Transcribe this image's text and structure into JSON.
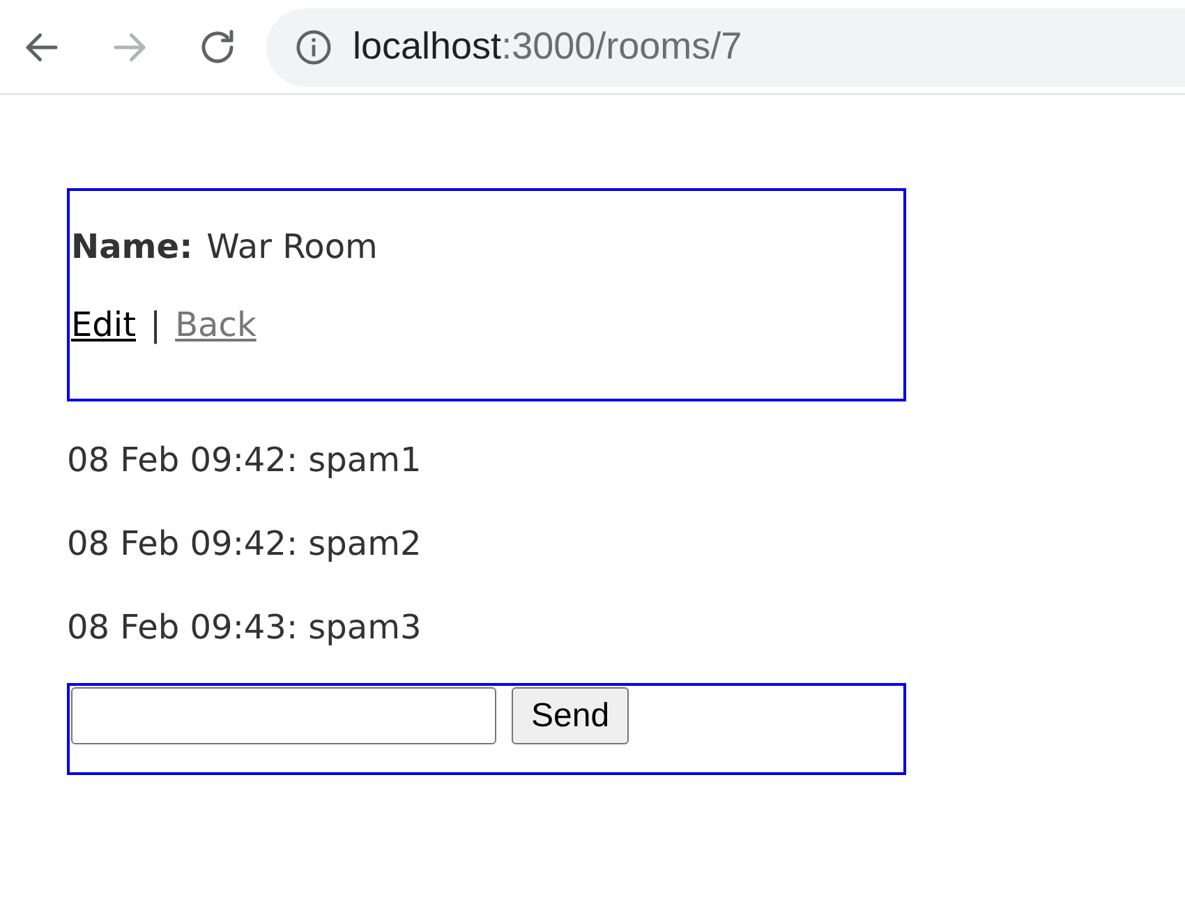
{
  "browser": {
    "nav": [
      {
        "kind": "back",
        "disabled": false
      },
      {
        "kind": "forward",
        "disabled": true
      },
      {
        "kind": "reload",
        "disabled": false
      }
    ],
    "address": {
      "host": "localhost",
      "path": ":3000/rooms/7"
    }
  },
  "room": {
    "label": "Name:",
    "name": "War Room",
    "links": [
      {
        "text": "Edit",
        "visited": false
      },
      {
        "text": "Back",
        "visited": true
      }
    ],
    "separator": "|"
  },
  "messages": [
    "08 Feb 09:42: spam1",
    "08 Feb 09:42: spam2",
    "08 Feb 09:43: spam3"
  ],
  "form": {
    "button": "Send"
  }
}
